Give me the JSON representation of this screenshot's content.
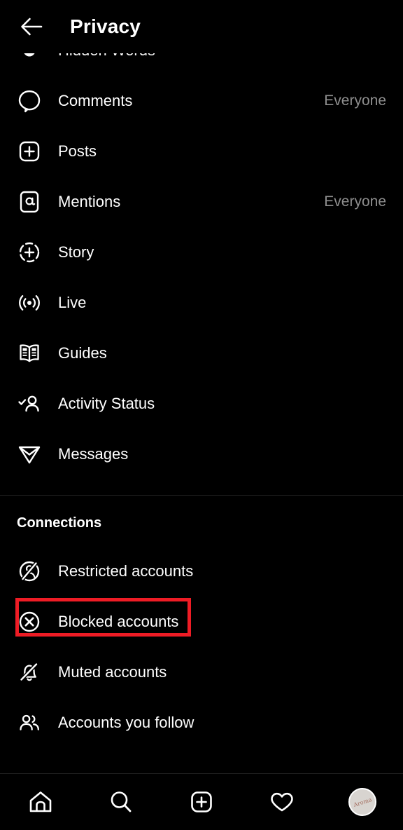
{
  "header": {
    "back_icon": "arrow-left-icon",
    "title": "Privacy"
  },
  "interactions": {
    "rows": [
      {
        "icon": "hidden-words-icon",
        "label": "Hidden Words",
        "value": ""
      },
      {
        "icon": "comment-bubble-icon",
        "label": "Comments",
        "value": "Everyone"
      },
      {
        "icon": "post-plus-square-icon",
        "label": "Posts",
        "value": ""
      },
      {
        "icon": "mention-at-icon",
        "label": "Mentions",
        "value": "Everyone"
      },
      {
        "icon": "story-plus-circle-icon",
        "label": "Story",
        "value": ""
      },
      {
        "icon": "live-broadcast-icon",
        "label": "Live",
        "value": ""
      },
      {
        "icon": "guides-book-icon",
        "label": "Guides",
        "value": ""
      },
      {
        "icon": "activity-status-icon",
        "label": "Activity Status",
        "value": ""
      },
      {
        "icon": "messages-paper-plane-icon",
        "label": "Messages",
        "value": ""
      }
    ]
  },
  "connections": {
    "section_title": "Connections",
    "rows": [
      {
        "icon": "restricted-account-icon",
        "label": "Restricted accounts",
        "value": ""
      },
      {
        "icon": "blocked-account-icon",
        "label": "Blocked accounts",
        "value": "",
        "highlighted": true
      },
      {
        "icon": "muted-bell-off-icon",
        "label": "Muted accounts",
        "value": ""
      },
      {
        "icon": "accounts-you-follow-icon",
        "label": "Accounts you follow",
        "value": ""
      }
    ]
  },
  "annotation": {
    "target_label": "Blocked accounts",
    "color": "#ee1c25"
  },
  "bottom_nav": {
    "items": [
      {
        "icon": "home-icon",
        "label": "Home"
      },
      {
        "icon": "search-icon",
        "label": "Search"
      },
      {
        "icon": "create-plus-square-icon",
        "label": "Create"
      },
      {
        "icon": "heart-activity-icon",
        "label": "Activity"
      },
      {
        "icon": "profile-avatar",
        "label": "Profile"
      }
    ]
  },
  "colors": {
    "background": "#000000",
    "primary_text": "#ffffff",
    "secondary_text": "#8e8e8e",
    "divider": "#1f1f1f",
    "annotation_red": "#ee1c25"
  }
}
